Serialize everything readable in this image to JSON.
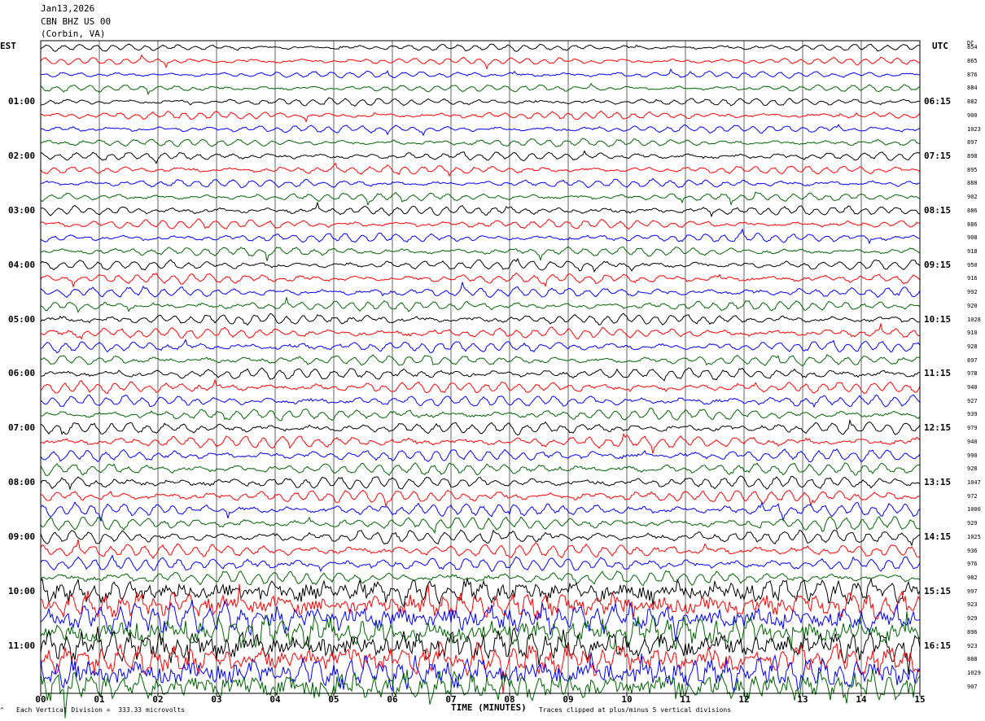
{
  "header": {
    "date": "Jan13,2026",
    "station": "CBN BHZ US 00",
    "location": "(Corbin, VA)"
  },
  "left_timezone": "EST",
  "right_timezone": "UTC",
  "dc_label": "DC",
  "left_hour_labels": [
    "01:00",
    "02:00",
    "03:00",
    "04:00",
    "05:00",
    "06:00",
    "07:00",
    "08:00",
    "09:00",
    "10:00",
    "11:00"
  ],
  "right_hour_labels": [
    "06:15",
    "07:15",
    "08:15",
    "09:15",
    "10:15",
    "11:15",
    "12:15",
    "13:15",
    "14:15",
    "15:15",
    "16:15"
  ],
  "dc_offsets": [
    "854",
    "865",
    "876",
    "884",
    "882",
    "900",
    "1023",
    "897",
    "898",
    "895",
    "888",
    "902",
    "886",
    "886",
    "908",
    "918",
    "950",
    "916",
    "992",
    "920",
    "1028",
    "910",
    "928",
    "897",
    "978",
    "940",
    "927",
    "939",
    "979",
    "940",
    "990",
    "928",
    "1047",
    "972",
    "1000",
    "929",
    "1025",
    "936",
    "976",
    "982",
    "997",
    "923",
    "929",
    "896",
    "923",
    "888",
    "1029",
    "907"
  ],
  "x_tick_labels": [
    "00",
    "01",
    "02",
    "03",
    "04",
    "05",
    "06",
    "07",
    "08",
    "09",
    "10",
    "11",
    "12",
    "13",
    "14",
    "15"
  ],
  "footer": {
    "left_mark": "^",
    "scale_text": "Each Vertical Division =  333.33 microvolts",
    "axis_title": "TIME (MINUTES)",
    "clip_text": "Traces clipped at plus/minus 5 vertical divisions"
  },
  "chart_data": {
    "type": "line",
    "title": "Jan13,2026 CBN BHZ US 00 (Corbin, VA)",
    "xlabel": "TIME (MINUTES)",
    "xlim": [
      0,
      15
    ],
    "trace_count": 48,
    "minutes_per_trace": 15,
    "microvolts_per_division": 333.33,
    "clip_divisions": 5,
    "trace_colors": [
      "#000000",
      "#ff0000",
      "#0000ff",
      "#006400"
    ],
    "grid": true
  }
}
